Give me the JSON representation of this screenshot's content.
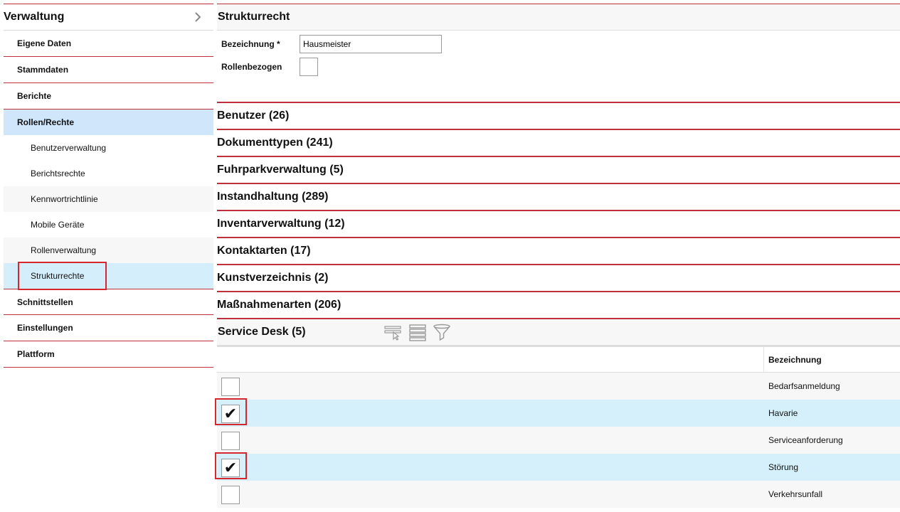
{
  "sidebar": {
    "title": "Verwaltung",
    "items": [
      {
        "label": "Eigene Daten"
      },
      {
        "label": "Stammdaten"
      },
      {
        "label": "Berichte"
      },
      {
        "label": "Rollen/Rechte"
      },
      {
        "label": "Schnittstellen"
      },
      {
        "label": "Einstellungen"
      },
      {
        "label": "Plattform"
      }
    ],
    "subitems": [
      {
        "label": "Benutzerverwaltung"
      },
      {
        "label": "Berichtsrechte"
      },
      {
        "label": "Kennwortrichtlinie"
      },
      {
        "label": "Mobile Geräte"
      },
      {
        "label": "Rollenverwaltung"
      },
      {
        "label": "Strukturrechte"
      }
    ]
  },
  "main": {
    "title": "Strukturrecht",
    "form": {
      "name_label": "Bezeichnung *",
      "name_value": "Hausmeister",
      "role_label": "Rollenbezogen"
    },
    "groups": [
      {
        "label": "Benutzer (26)"
      },
      {
        "label": "Dokumenttypen (241)"
      },
      {
        "label": "Fuhrparkverwaltung (5)"
      },
      {
        "label": "Instandhaltung (289)"
      },
      {
        "label": "Inventarverwaltung (12)"
      },
      {
        "label": "Kontaktarten (17)"
      },
      {
        "label": "Kunstverzeichnis (2)"
      },
      {
        "label": "Maßnahmenarten (206)"
      }
    ],
    "service_desk": {
      "label": "Service Desk (5)",
      "column_header": "Bezeichnung",
      "rows": [
        {
          "label": "Bedarfsanmeldung",
          "checked": false,
          "mark": ""
        },
        {
          "label": "Havarie",
          "checked": true,
          "mark": "✔"
        },
        {
          "label": "Serviceanforderung",
          "checked": false,
          "mark": ""
        },
        {
          "label": "Störung",
          "checked": true,
          "mark": "✔"
        },
        {
          "label": "Verkehrsunfall",
          "checked": false,
          "mark": ""
        }
      ]
    }
  },
  "colors": {
    "accent_red": "#c0303a",
    "highlight_red": "#d6262e",
    "active_blue": "#cfe6fb",
    "selected_row": "#d5f0fb"
  }
}
